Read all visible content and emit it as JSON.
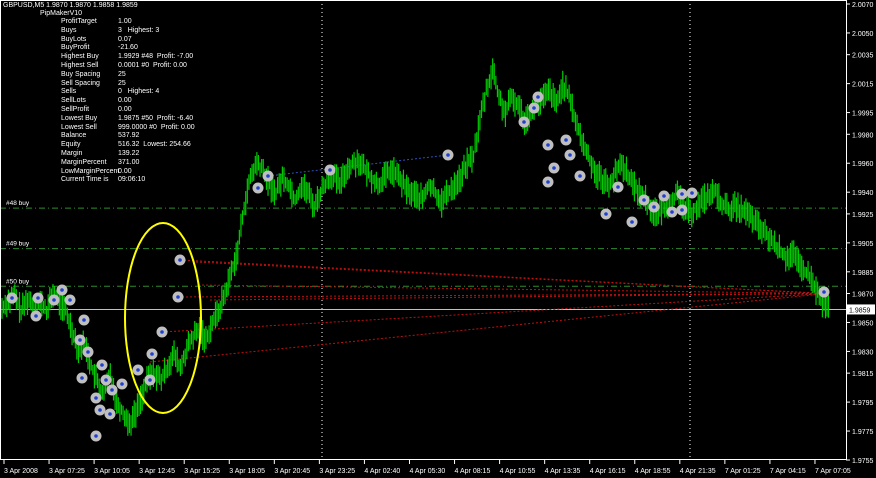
{
  "header": {
    "symbol_line": "GBPUSD,M5  1.9870 1.9870 1.9858 1.9859",
    "expert": "PipMakerV10"
  },
  "info_panel": [
    {
      "k": "ProfitTarget",
      "v": "1.00"
    },
    {
      "k": "Buys",
      "v": "3   Highest: 3"
    },
    {
      "k": "BuyLots",
      "v": "0.07"
    },
    {
      "k": "BuyProfit",
      "v": "-21.60"
    },
    {
      "k": "Highest Buy",
      "v": "1.9929 #48  Profit: -7.00"
    },
    {
      "k": "Highest Sell",
      "v": "0.0001 #0  Profit: 0.00"
    },
    {
      "k": "",
      "v": ""
    },
    {
      "k": "Buy Spacing",
      "v": "25"
    },
    {
      "k": "Sell Spacing",
      "v": "25"
    },
    {
      "k": "",
      "v": ""
    },
    {
      "k": "Sells",
      "v": "0   Highest: 4"
    },
    {
      "k": "SellLots",
      "v": "0.00"
    },
    {
      "k": "SellProfit",
      "v": "0.00"
    },
    {
      "k": "Lowest Buy",
      "v": "1.9875 #50  Profit: -6.40"
    },
    {
      "k": "Lowest Sell",
      "v": "999.0000 #0  Profit: 0.00"
    },
    {
      "k": "",
      "v": ""
    },
    {
      "k": "Balance",
      "v": "537.92"
    },
    {
      "k": "Equity",
      "v": "516.32  Lowest: 254.66"
    },
    {
      "k": "",
      "v": ""
    },
    {
      "k": "Margin",
      "v": "139.22"
    },
    {
      "k": "MarginPercent",
      "v": "371.00"
    },
    {
      "k": "LowMarginPercent",
      "v": "0.00"
    },
    {
      "k": "Current Time is",
      "v": "09:06:10"
    }
  ],
  "colors": {
    "background": "#000000",
    "candles": "#00cc00",
    "levels": "#2e8b2e",
    "current_price_line": "#c0c0c0",
    "trade_lines": "#c01010",
    "highlight_ellipse": "#ffff00",
    "axis": "#ffffff"
  },
  "chart_data": {
    "type": "line",
    "title": "",
    "ylim": [
      1.9755,
      2.007
    ],
    "y_ticks": [
      "2.0070",
      "2.0050",
      "2.0035",
      "2.0015",
      "1.9995",
      "1.9980",
      "1.9960",
      "1.9940",
      "1.9925",
      "1.9905",
      "1.9885",
      "1.9870",
      "1.9850",
      "1.9830",
      "1.9815",
      "1.9795",
      "1.9775",
      "1.9755"
    ],
    "x_ticks": [
      "3 Apr 2008",
      "3 Apr 07:25",
      "3 Apr 10:05",
      "3 Apr 12:45",
      "3 Apr 15:25",
      "3 Apr 18:05",
      "3 Apr 20:45",
      "3 Apr 23:25",
      "4 Apr 02:40",
      "4 Apr 05:30",
      "4 Apr 08:15",
      "4 Apr 10:55",
      "4 Apr 13:35",
      "4 Apr 16:15",
      "4 Apr 18:55",
      "4 Apr 21:35",
      "7 Apr 01:25",
      "7 Apr 04:15",
      "7 Apr 07:05"
    ],
    "current_price": "1.9859",
    "levels": [
      {
        "label": "#48 buy",
        "price": 1.9929
      },
      {
        "label": "#49 buy",
        "price": 1.9901
      },
      {
        "label": "#50 buy",
        "price": 1.9875
      }
    ],
    "series": [
      {
        "values": [
          1.986,
          1.9865,
          1.9868,
          1.9858,
          1.9866,
          1.9862,
          1.9864,
          1.9858,
          1.987,
          1.9864,
          1.9858,
          1.9845,
          1.9832,
          1.9835,
          1.982,
          1.9808,
          1.98,
          1.9815,
          1.9795,
          1.9788,
          1.978,
          1.9788,
          1.98,
          1.9812,
          1.9815,
          1.981,
          1.982,
          1.9828,
          1.9818,
          1.9832,
          1.984,
          1.9845,
          1.9838,
          1.985,
          1.9858,
          1.987,
          1.9885,
          1.99,
          1.993,
          1.995,
          1.996,
          1.9955,
          1.9945,
          1.994,
          1.995,
          1.9945,
          1.9935,
          1.9945,
          1.994,
          1.993,
          1.994,
          1.9948,
          1.9952,
          1.9945,
          1.9955,
          1.996,
          1.9962,
          1.9955,
          1.995,
          1.9945,
          1.995,
          1.9955,
          1.9952,
          1.9945,
          1.994,
          1.9938,
          1.9935,
          1.9945,
          1.994,
          1.9933,
          1.994,
          1.9945,
          1.995,
          1.996,
          1.9965,
          1.999,
          2.001,
          2.0025,
          2.0005,
          1.9995,
          2.0005,
          2.0,
          1.999,
          1.9995,
          2.0,
          2.0005,
          2.001,
          2.0,
          2.0015,
          2.0005,
          1.999,
          1.9975,
          1.9965,
          1.9955,
          1.995,
          1.9945,
          1.995,
          1.996,
          1.9955,
          1.9945,
          1.994,
          1.9935,
          1.9928,
          1.9925,
          1.993,
          1.9935,
          1.9938,
          1.993,
          1.9925,
          1.993,
          1.9935,
          1.9938,
          1.994,
          1.9932,
          1.9928,
          1.993,
          1.9928,
          1.9925,
          1.992,
          1.9915,
          1.991,
          1.9905,
          1.99,
          1.9895,
          1.9898,
          1.989,
          1.9885,
          1.988,
          1.987,
          1.9862
        ]
      }
    ]
  }
}
